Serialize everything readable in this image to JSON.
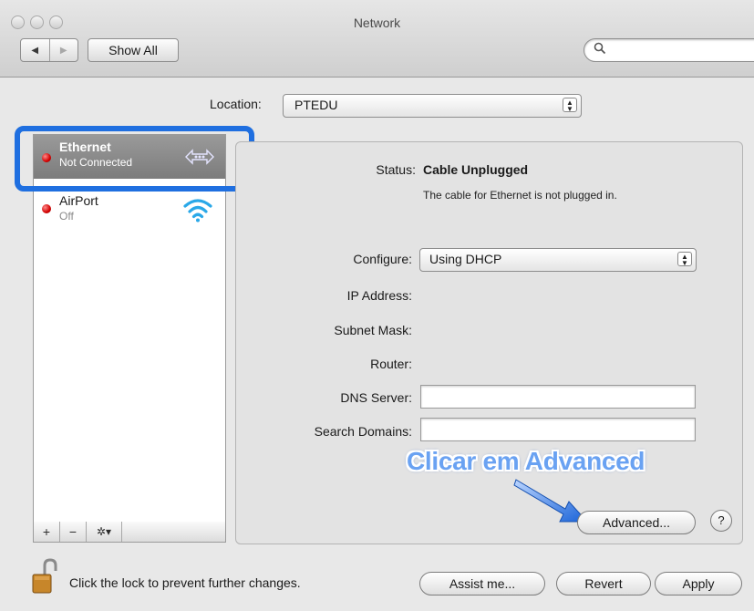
{
  "window": {
    "title": "Network"
  },
  "toolbar": {
    "back_glyph": "◀",
    "forward_glyph": "▶",
    "show_all_label": "Show All",
    "search_placeholder": "",
    "search_icon": "magnifier-icon"
  },
  "location": {
    "label": "Location:",
    "value": "PTEDU"
  },
  "services": [
    {
      "name": "Ethernet",
      "status": "Not Connected",
      "icon": "ethernet-icon",
      "selected": true,
      "status_color": "#d20000"
    },
    {
      "name": "AirPort",
      "status": "Off",
      "icon": "wifi-icon",
      "selected": false,
      "status_color": "#d20000"
    }
  ],
  "list_toolbar": {
    "add": "+",
    "remove": "−",
    "action": "✲▾"
  },
  "detail": {
    "status_label": "Status:",
    "status_value": "Cable Unplugged",
    "status_detail": "The cable for Ethernet is not plugged in.",
    "configure_label": "Configure:",
    "configure_value": "Using DHCP",
    "ip_label": "IP Address:",
    "subnet_label": "Subnet Mask:",
    "router_label": "Router:",
    "dns_label": "DNS Server:",
    "dns_value": "",
    "search_domains_label": "Search Domains:",
    "search_domains_value": "",
    "advanced_label": "Advanced...",
    "help_label": "?"
  },
  "annotation": {
    "callout_text": "Clicar em Advanced",
    "highlight_color": "#1f6fe0"
  },
  "footer": {
    "lock_text": "Click the lock to prevent further changes.",
    "assist_label": "Assist me...",
    "revert_label": "Revert",
    "apply_label": "Apply"
  }
}
